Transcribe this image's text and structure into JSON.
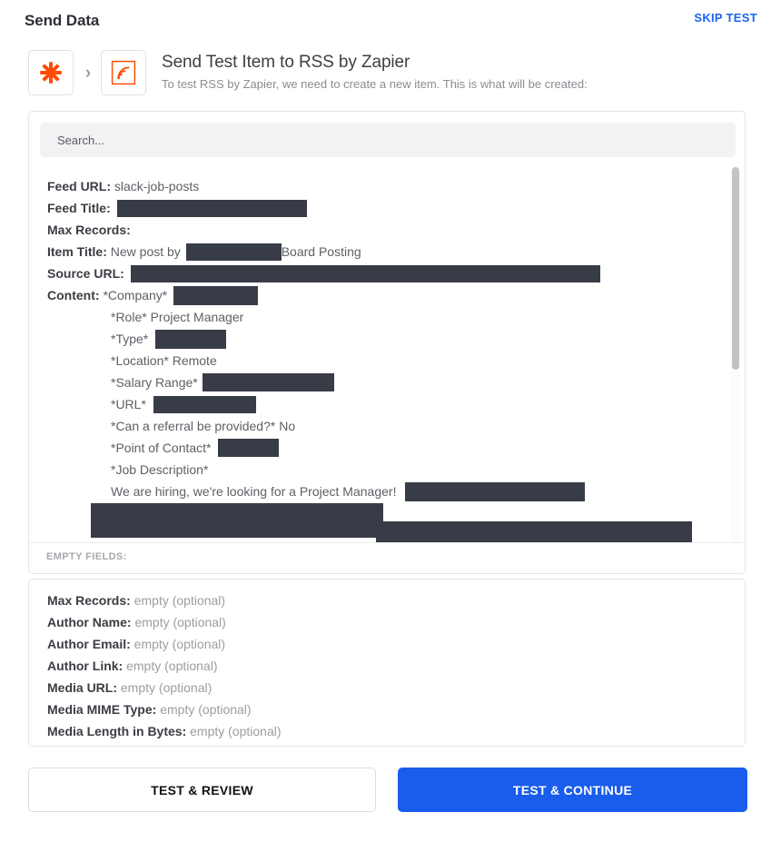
{
  "topbar": {
    "title": "Send Data",
    "skip_label": "SKIP TEST"
  },
  "header": {
    "title": "Send Test Item to RSS by Zapier",
    "subtitle": "To test RSS by Zapier, we need to create a new item. This is what will be created:",
    "icons": {
      "left": "zapier-logo-icon",
      "arrow": "chevron-right-icon",
      "right": "rss-feed-icon"
    },
    "colors": {
      "brand_orange": "#ff4a00",
      "accent_blue": "#1a5ceb",
      "redaction": "#383c47"
    }
  },
  "search": {
    "placeholder": "Search...",
    "value": ""
  },
  "fields": [
    {
      "label": "Feed URL:",
      "value": "slack-job-posts",
      "redacted": false
    },
    {
      "label": "Feed Title:",
      "value": "",
      "redacted": true
    },
    {
      "label": "Max Records:",
      "value": "",
      "redacted": false
    },
    {
      "label": "Item Title:",
      "value": "New post by",
      "value_tail": "Board Posting",
      "redacted": true
    },
    {
      "label": "Source URL:",
      "value": "",
      "redacted": true
    },
    {
      "label": "Content:",
      "value": "*Company*",
      "redacted": true
    }
  ],
  "content_lines": [
    {
      "text": "*Role* Project Manager",
      "redacted": false
    },
    {
      "text": "*Type*",
      "redacted": true
    },
    {
      "text": "*Location* Remote",
      "redacted": false
    },
    {
      "text": "*Salary Range*",
      "redacted": true
    },
    {
      "text": "*URL*",
      "redacted": true
    },
    {
      "text": "*Can a referral be provided?* No",
      "redacted": false
    },
    {
      "text": "*Point of Contact*",
      "redacted": true
    },
    {
      "text": "*Job Description*",
      "redacted": false
    },
    {
      "text": "We are hiring, we're looking for a Project Manager!",
      "redacted": true
    }
  ],
  "empty_fields_header": "EMPTY FIELDS:",
  "empty_fields": [
    {
      "label": "Max Records:",
      "value": "empty (optional)"
    },
    {
      "label": "Author Name:",
      "value": "empty (optional)"
    },
    {
      "label": "Author Email:",
      "value": "empty (optional)"
    },
    {
      "label": "Author Link:",
      "value": "empty (optional)"
    },
    {
      "label": "Media URL:",
      "value": "empty (optional)"
    },
    {
      "label": "Media MIME Type:",
      "value": "empty (optional)"
    },
    {
      "label": "Media Length in Bytes:",
      "value": "empty (optional)"
    }
  ],
  "footer": {
    "secondary_label": "TEST & REVIEW",
    "primary_label": "TEST & CONTINUE"
  }
}
